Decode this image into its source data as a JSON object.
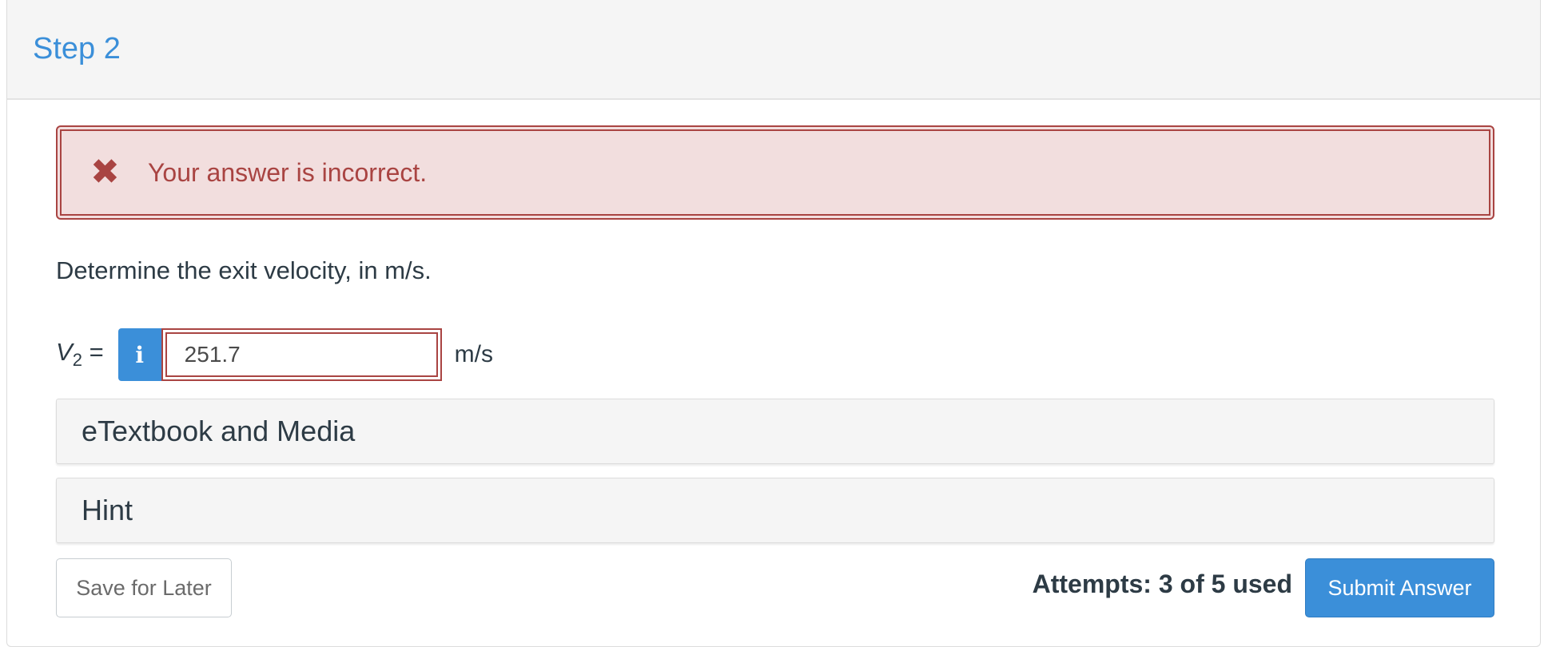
{
  "header": {
    "title": "Step 2"
  },
  "alert": {
    "icon": "close-x-icon",
    "message": "Your answer is incorrect.",
    "color": "#a94442"
  },
  "question": {
    "text": "Determine the exit velocity, in m/s."
  },
  "answer": {
    "variable": "V",
    "subscript": "2",
    "equals": "=",
    "info_icon": "i",
    "value": "251.7",
    "unit": "m/s"
  },
  "sections": [
    {
      "label": "eTextbook and Media"
    },
    {
      "label": "Hint"
    }
  ],
  "footer": {
    "save_label": "Save for Later",
    "attempts_text": "Attempts: 3 of 5 used",
    "submit_label": "Submit Answer"
  },
  "colors": {
    "accent": "#3b8fd9",
    "error": "#a94442",
    "error_bg": "#f2dede"
  }
}
